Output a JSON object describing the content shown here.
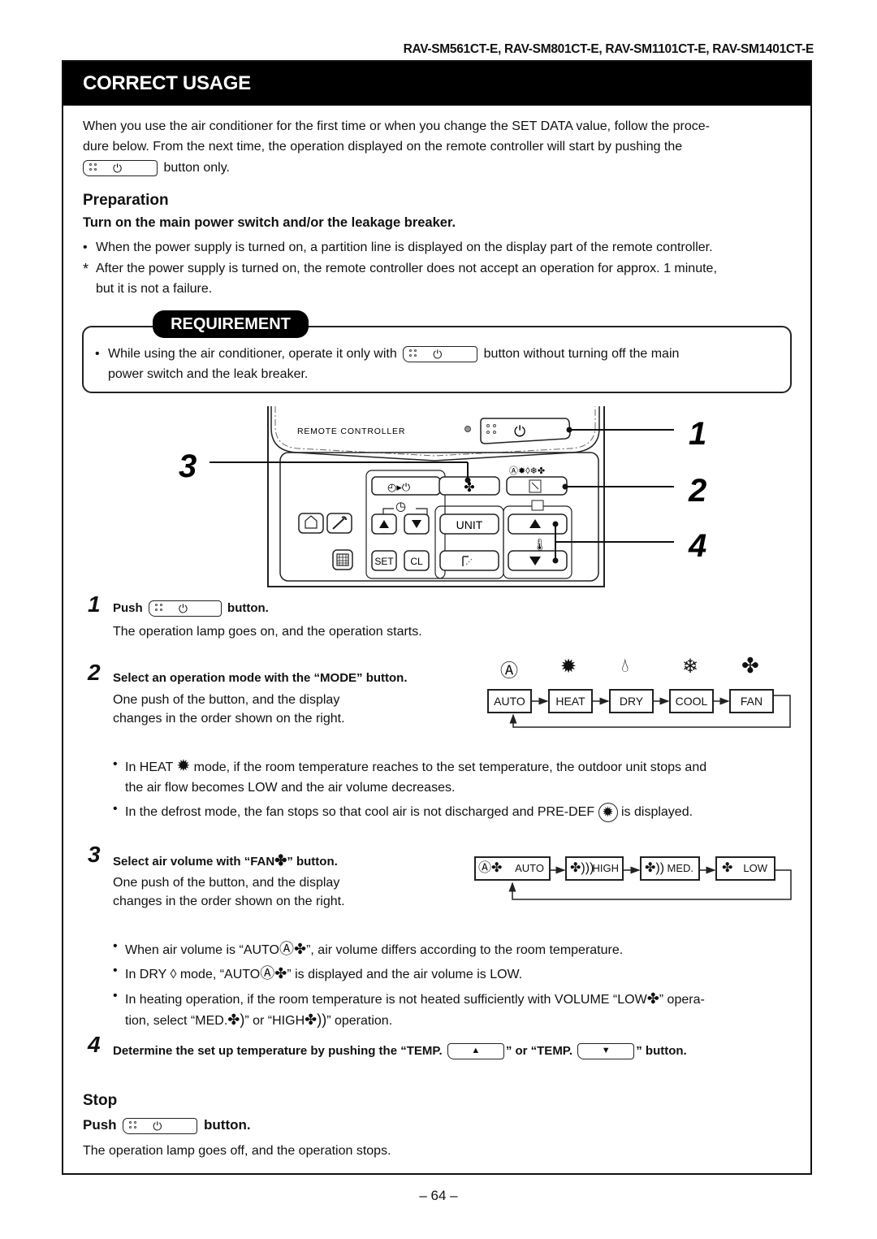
{
  "header": {
    "models": "RAV-SM561CT-E, RAV-SM801CT-E, RAV-SM1101CT-E, RAV-SM1401CT-E",
    "title": "CORRECT USAGE"
  },
  "intro": {
    "line1": "When you use the air conditioner for the first time or when you change the SET DATA value, follow the proce-",
    "line2": "dure below. From the next time, the operation displayed on the remote controller will start by pushing the",
    "line3_suffix": "button only."
  },
  "preparation": {
    "heading": "Preparation",
    "subheading": "Turn on the main power switch and/or the leakage breaker.",
    "bullets": [
      {
        "marker": "•",
        "text": "When the power supply is turned on, a partition line is displayed on the display part of the remote controller."
      },
      {
        "marker": "*",
        "line1": "After the power supply is turned on, the remote controller does not accept an operation for approx. 1 minute,",
        "line2": "but it is not a failure."
      }
    ]
  },
  "requirement": {
    "label": "REQUIREMENT",
    "prefix": "While using the air conditioner, operate it only with",
    "suffix": "button without turning off the main",
    "line2": "power switch and the leak breaker."
  },
  "remote": {
    "label": "REMOTE CONTROLLER",
    "buttons": {
      "unit": "UNIT",
      "set": "SET",
      "cl": "CL"
    },
    "mode_icons": [
      "auto-icon",
      "heat-icon",
      "dry-icon",
      "cool-icon",
      "fan-icon"
    ],
    "callouts": [
      "1",
      "2",
      "3",
      "4"
    ]
  },
  "steps": [
    {
      "number": "1",
      "title_prefix": "Push",
      "title_suffix": "button.",
      "body": "The operation lamp goes on, and the operation starts."
    },
    {
      "number": "2",
      "title": "Select an operation mode with the “MODE” button.",
      "body1": "One push of the button, and the display",
      "body2": "changes in the order shown on the right.",
      "modes": [
        "AUTO",
        "HEAT",
        "DRY",
        "COOL",
        "FAN"
      ],
      "notes": [
        {
          "prefix": "In HEAT",
          "suffix": "mode, if the room temperature reaches to the set temperature, the outdoor unit stops and",
          "line2": "the air flow becomes LOW and the air volume decreases."
        },
        {
          "prefix": "In the defrost mode, the fan stops so that cool air is not discharged and PRE-DEF",
          "suffix": "is displayed."
        }
      ]
    },
    {
      "number": "3",
      "title_prefix": "Select air volume with “FAN",
      "title_suffix": "” button.",
      "body1": "One push of the button, and the display",
      "body2": "changes in the order shown on the right.",
      "volumes": [
        "AUTO",
        "HIGH",
        "MED.",
        "LOW"
      ],
      "notes": [
        {
          "prefix": "When air volume is “AUTO",
          "suffix": "”, air volume differs according to the room temperature."
        },
        {
          "prefix": "In DRY",
          "middle": "mode, “AUTO",
          "suffix": "” is displayed and the air volume is LOW."
        },
        {
          "prefix": "In heating operation, if the room temperature is not heated sufficiently with VOLUME “LOW",
          "suffix": "” opera-",
          "line2_prefix": "tion, select “MED.",
          "line2_middle": "” or “HIGH",
          "line2_suffix": "” operation."
        }
      ]
    },
    {
      "number": "4",
      "title_prefix": "Determine the set up temperature by pushing the “TEMP.",
      "title_middle": "” or “TEMP.",
      "title_suffix": "”  button."
    }
  ],
  "stop": {
    "heading": "Stop",
    "push_prefix": "Push",
    "push_suffix": "button.",
    "body": "The operation lamp goes off, and the operation stops."
  },
  "footer": {
    "page_number": "– 64 –"
  }
}
